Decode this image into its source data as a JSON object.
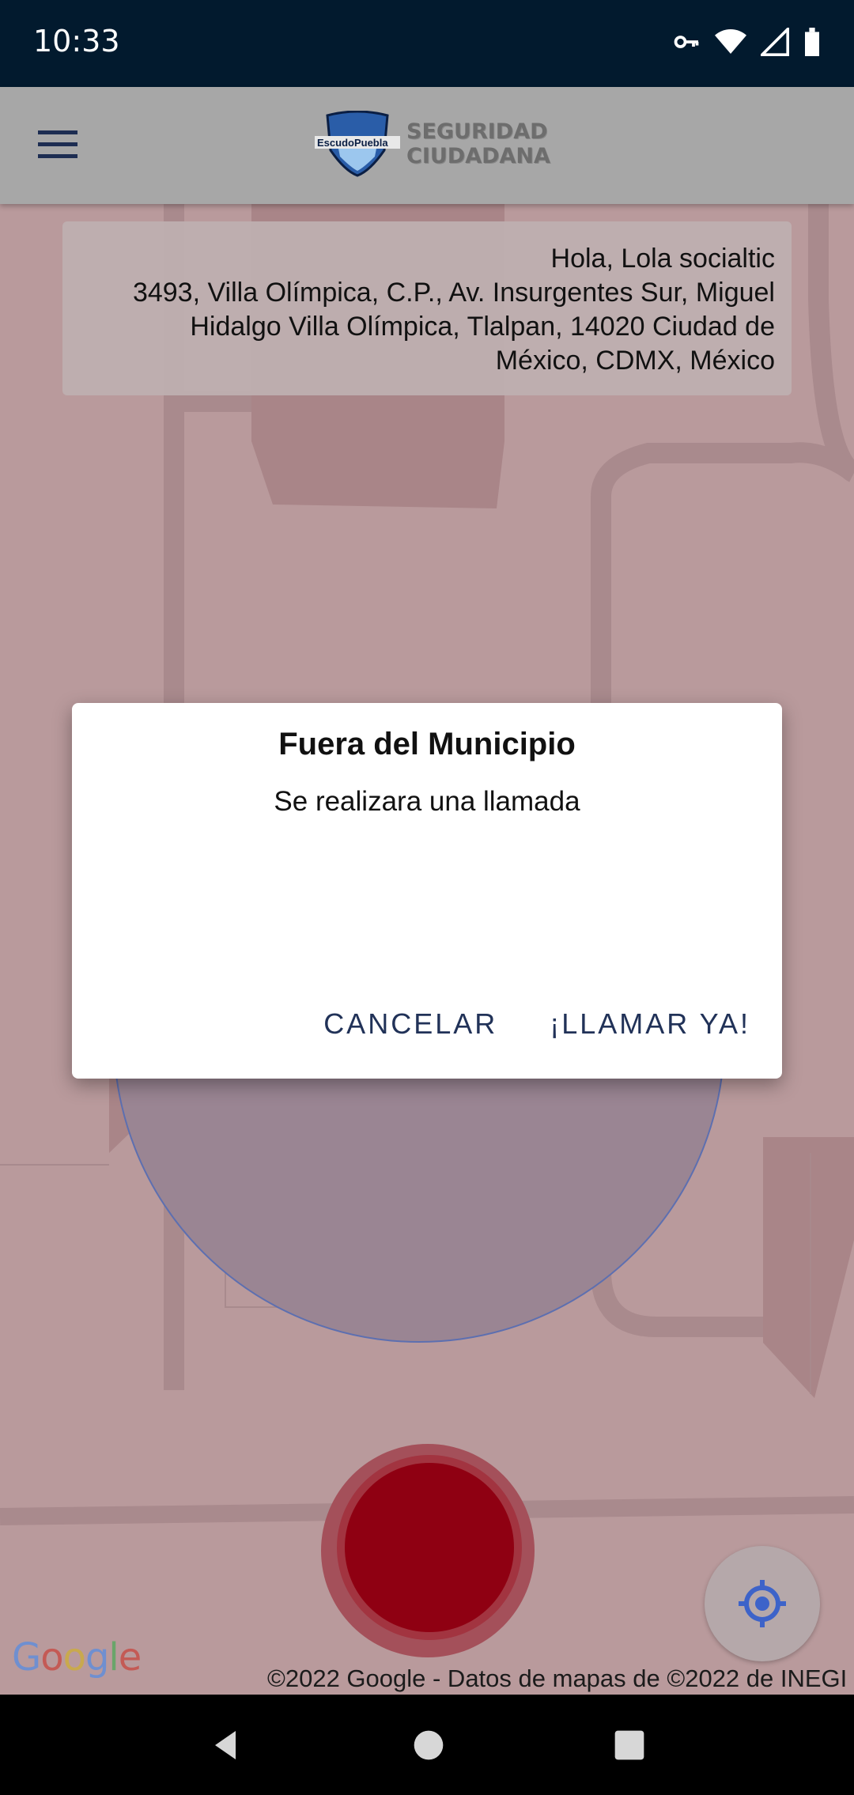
{
  "status_bar": {
    "time": "10:33"
  },
  "app_bar": {
    "logo_line1": "SEGURIDAD",
    "logo_line2": "CIUDADANA",
    "logo_badge": "EscudoPuebla"
  },
  "info_card": {
    "greeting": "Hola, Lola socialtic",
    "address_line1": "3493, Villa Olímpica, C.P., Av. Insurgentes Sur, Miguel",
    "address_line2": "Hidalgo Villa Olímpica, Tlalpan, 14020 Ciudad de",
    "address_line3": "México, CDMX, México"
  },
  "dialog": {
    "title": "Fuera del Municipio",
    "message": "Se realizara una llamada",
    "cancel_label": "CANCELAR",
    "confirm_label": "¡LLAMAR YA!"
  },
  "map": {
    "google_logo": "Google",
    "copyright": "©2022 Google - Datos de mapas de ©2022 de INEGI"
  },
  "colors": {
    "accent": "#213258",
    "alert_red": "#8f0012",
    "status_bar": "#021a2e"
  },
  "icons": [
    "key-icon",
    "wifi-icon",
    "signal-icon",
    "battery-icon",
    "menu-icon",
    "my-location-icon",
    "back-icon",
    "home-icon",
    "recents-icon"
  ]
}
